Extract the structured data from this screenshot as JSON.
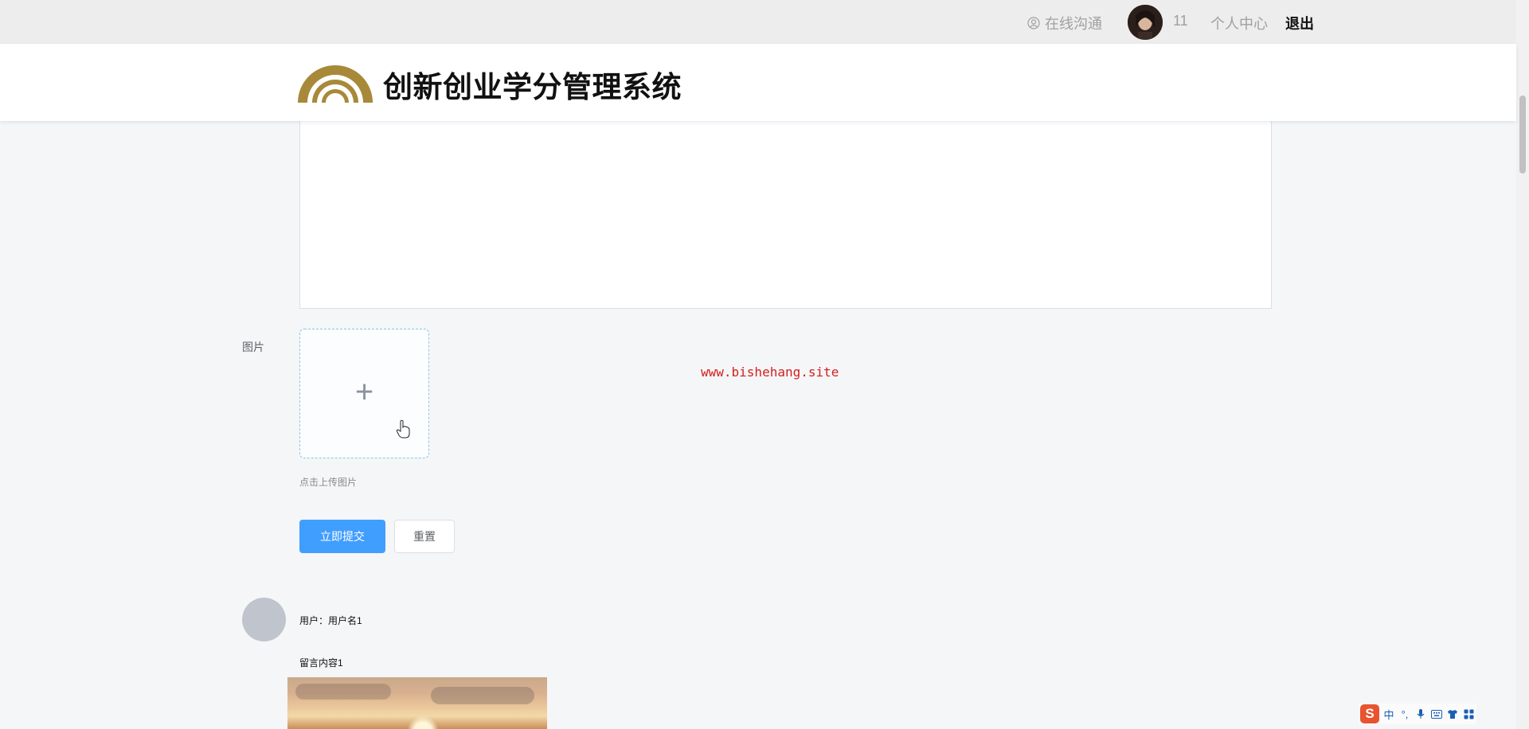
{
  "topbar": {
    "chat_label": "在线沟通",
    "username": "11",
    "center_label": "个人中心",
    "logout_label": "退出"
  },
  "header": {
    "title": "创新创业学分管理系统",
    "logo_color": "#a8893a"
  },
  "form": {
    "image_label": "图片",
    "upload_tip": "点击上传图片",
    "submit_label": "立即提交",
    "reset_label": "重置"
  },
  "watermark": "www.bishehang.site",
  "comments": [
    {
      "user_label": "用户：用户名1",
      "content": "留言内容1"
    }
  ],
  "ime": {
    "logo": "S",
    "lang": "中",
    "punct": "°,"
  },
  "colors": {
    "primary": "#409eff",
    "topbar_bg": "#ededed",
    "page_bg": "#f5f6f7",
    "watermark": "#d51e1e"
  }
}
